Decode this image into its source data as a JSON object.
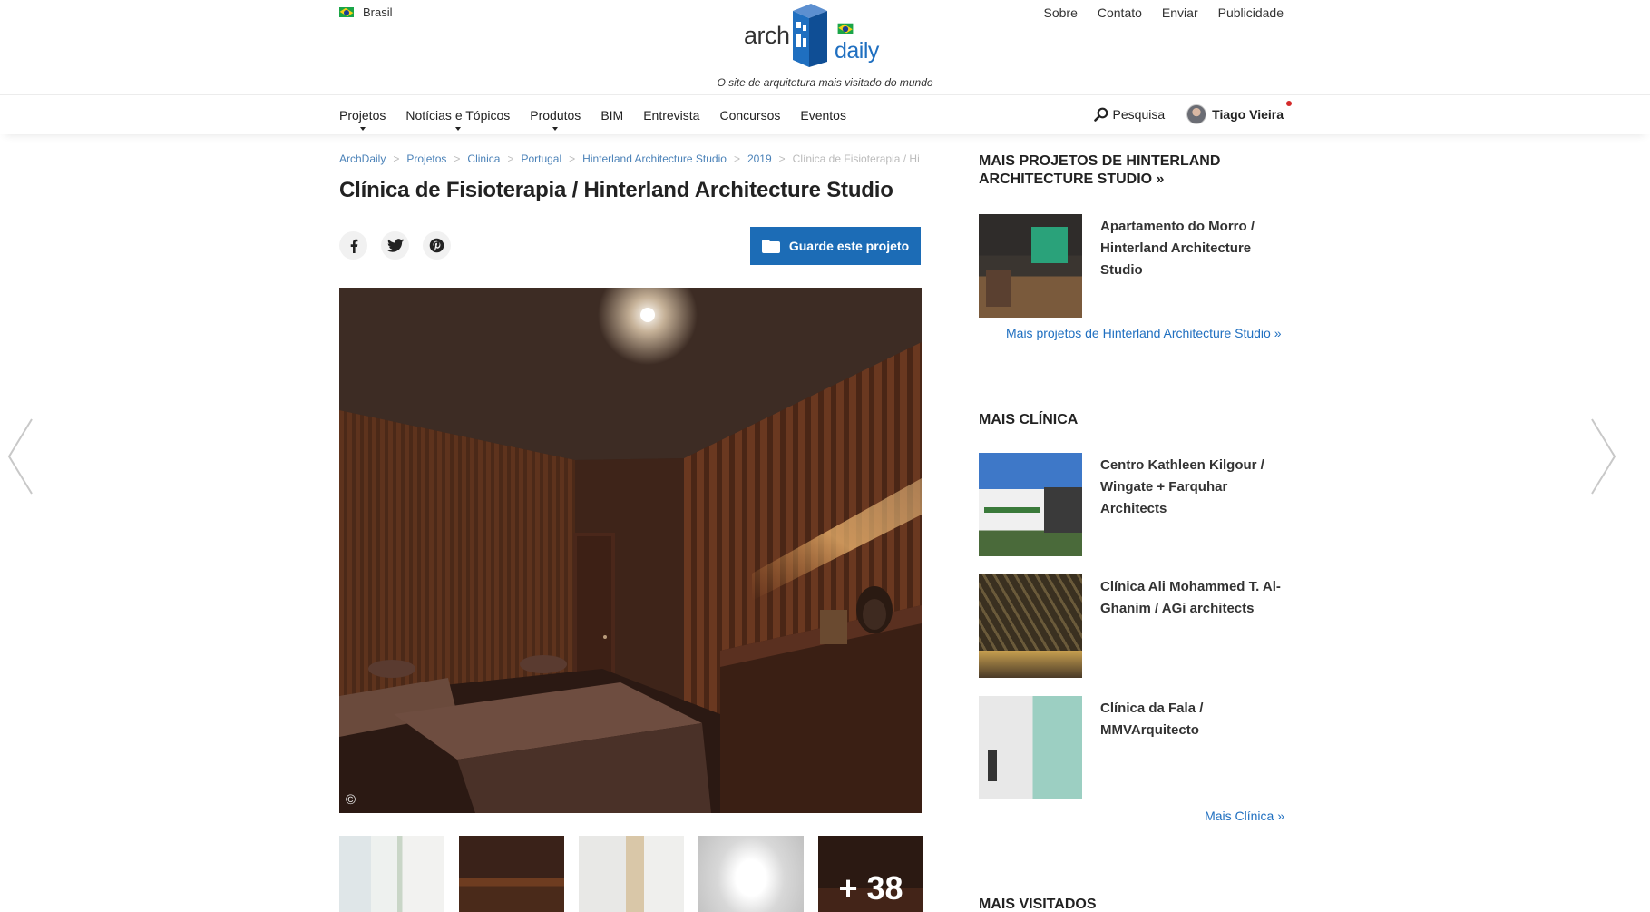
{
  "header": {
    "region": "Brasil",
    "top_links": [
      "Sobre",
      "Contato",
      "Enviar",
      "Publicidade"
    ],
    "logo_arch": "arch",
    "logo_daily": "daily",
    "tagline": "O site de arquitetura mais visitado do mundo"
  },
  "nav": {
    "items": [
      {
        "label": "Projetos",
        "dropdown": true
      },
      {
        "label": "Notícias e Tópicos",
        "dropdown": true
      },
      {
        "label": "Produtos",
        "dropdown": true
      },
      {
        "label": "BIM",
        "dropdown": false
      },
      {
        "label": "Entrevista",
        "dropdown": false
      },
      {
        "label": "Concursos",
        "dropdown": false
      },
      {
        "label": "Eventos",
        "dropdown": false
      }
    ],
    "search_label": "Pesquisa",
    "user_name": "Tiago Vieira"
  },
  "breadcrumb": [
    "ArchDaily",
    "Projetos",
    "Clinica",
    "Portugal",
    "Hinterland Architecture Studio",
    "2019",
    "Clínica de Fisioterapia / Hi"
  ],
  "page": {
    "title": "Clínica de Fisioterapia / Hinterland Architecture Studio",
    "save_label": "Guarde este projeto",
    "copyright_symbol": "©",
    "more_photos": "+ 38"
  },
  "sidebar": {
    "more_projects_heading": "MAIS PROJETOS DE HINTERLAND ARCHITECTURE STUDIO »",
    "more_projects": [
      {
        "title": "Apartamento do Morro / Hinterland Architecture Studio"
      }
    ],
    "more_projects_link": "Mais projetos de Hinterland Architecture Studio »",
    "more_clinic_heading": "MAIS CLÍNICA",
    "more_clinic": [
      {
        "title": "Centro Kathleen Kilgour / Wingate + Farquhar Architects"
      },
      {
        "title": "Clínica Ali Mohammed T. Al-Ghanim / AGi architects"
      },
      {
        "title": "Clínica da Fala / MMVArquitecto"
      }
    ],
    "more_clinic_link": "Mais Clínica »",
    "most_visited_heading": "MAIS VISITADOS"
  },
  "colors": {
    "accent": "#1c6cb6",
    "link": "#1f6fc0",
    "breadcrumb": "#4b82b8",
    "notification": "#d42a2a"
  }
}
